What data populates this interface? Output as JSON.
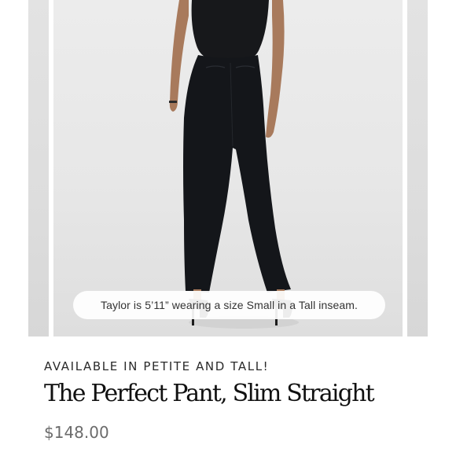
{
  "gallery": {
    "image_caption": "Taylor is 5’11” wearing a size Small in a Tall inseam."
  },
  "product": {
    "eyebrow": "AVAILABLE IN PETITE AND TALL!",
    "title": "The Perfect Pant, Slim Straight",
    "price": "$148.00"
  },
  "colors": {
    "pant": "#14161a",
    "title_text": "#111111",
    "price_text": "#6b6b6b"
  }
}
